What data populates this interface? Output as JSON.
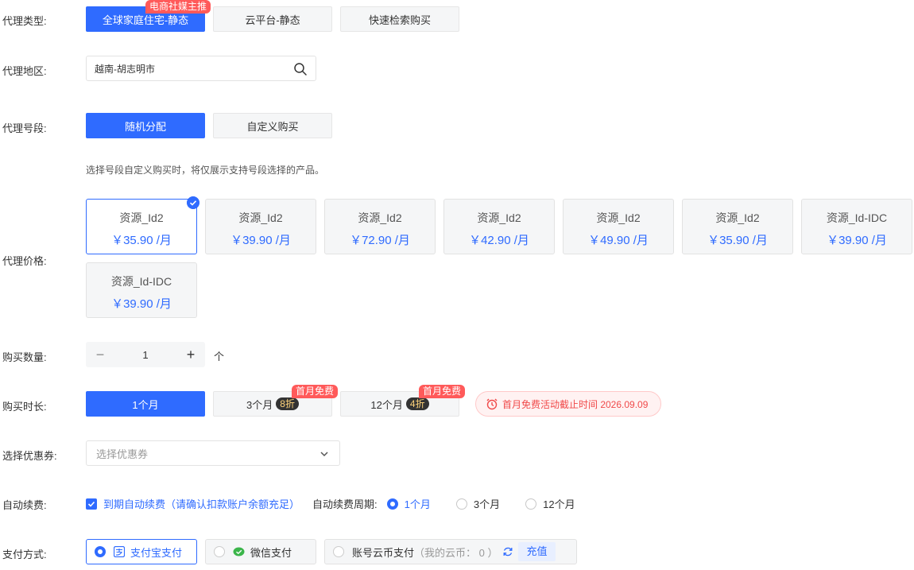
{
  "labels": {
    "proxy_type": "代理类型:",
    "proxy_region": "代理地区:",
    "proxy_segment": "代理号段:",
    "proxy_price": "代理价格:",
    "quantity": "购买数量:",
    "duration": "购买时长:",
    "coupon": "选择优惠券:",
    "auto_renew": "自动续费:",
    "payment": "支付方式:"
  },
  "proxy_types": [
    {
      "label": "全球家庭住宅-静态",
      "active": true,
      "tag": "电商社媒主推"
    },
    {
      "label": "云平台-静态",
      "active": false
    },
    {
      "label": "快速检索购买",
      "active": false
    }
  ],
  "region": {
    "value": "越南-胡志明市",
    "icon": "search-icon"
  },
  "segments": [
    {
      "label": "随机分配",
      "active": true
    },
    {
      "label": "自定义购买",
      "active": false
    }
  ],
  "segment_hint": "选择号段自定义购买时，将仅展示支持号段选择的产品。",
  "prices": [
    {
      "name": "资源_Id2",
      "price": "￥35.90 /月",
      "active": true
    },
    {
      "name": "资源_Id2",
      "price": "￥39.90 /月",
      "active": false
    },
    {
      "name": "资源_Id2",
      "price": "￥72.90 /月",
      "active": false
    },
    {
      "name": "资源_Id2",
      "price": "￥42.90 /月",
      "active": false
    },
    {
      "name": "资源_Id2",
      "price": "￥49.90 /月",
      "active": false
    },
    {
      "name": "资源_Id2",
      "price": "￥35.90 /月",
      "active": false
    },
    {
      "name": "资源_Id-IDC",
      "price": "￥39.90 /月",
      "active": false
    },
    {
      "name": "资源_Id-IDC",
      "price": "￥39.90 /月",
      "active": false
    }
  ],
  "quantity": {
    "minus": "−",
    "value": "1",
    "plus": "+",
    "unit": "个"
  },
  "durations": [
    {
      "label": "1个月",
      "active": true
    },
    {
      "label": "3个月",
      "discount": "8折",
      "tag": "首月免费",
      "active": false
    },
    {
      "label": "12个月",
      "discount": "4折",
      "tag": "首月免费",
      "active": false
    }
  ],
  "promo_notice": "首月免费活动截止时间 2026.09.09",
  "coupon": {
    "placeholder": "选择优惠券"
  },
  "auto_renew": {
    "checkbox_label": "到期自动续费（请确认扣款账户余额充足）",
    "cycle_label": "自动续费周期:",
    "cycles": [
      {
        "label": "1个月",
        "selected": true
      },
      {
        "label": "3个月",
        "selected": false
      },
      {
        "label": "12个月",
        "selected": false
      }
    ]
  },
  "payment": {
    "alipay": "支付宝支付",
    "wechat": "微信支付",
    "account": "账号云币支付",
    "balance_text": "（我的云币： 0 ）",
    "recharge": "充值"
  },
  "colors": {
    "accent": "#2f6bff",
    "tag_red": "#ff5a5a",
    "notice_red": "#f04a4a"
  }
}
